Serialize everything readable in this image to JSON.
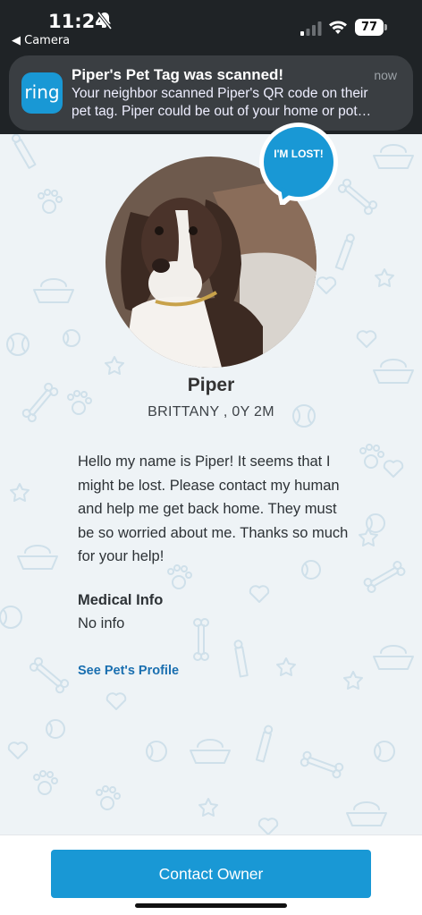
{
  "status_bar": {
    "time": "11:24",
    "back_label": "◀ Camera",
    "battery": "77"
  },
  "notification": {
    "app_logo": "ring",
    "title": "Piper's Pet Tag was scanned!",
    "time": "now",
    "body_line1": "Your neighbor scanned Piper's QR code on their",
    "body_line2": "pet tag. Piper could be out of your home or pot…"
  },
  "pet": {
    "lost_badge": "I'M LOST!",
    "name": "Piper",
    "breed_age": "BRITTANY , 0Y 2M",
    "message": "Hello my name is Piper! It seems that I might be lost. Please contact my human and help me get back home. They must be so worried about me. Thanks so much for your help!",
    "medical_title": "Medical Info",
    "medical_value": "No info",
    "profile_link": "See Pet's Profile"
  },
  "actions": {
    "contact_label": "Contact Owner"
  },
  "colors": {
    "accent": "#1998d5",
    "link": "#1a6fb0",
    "pattern": "#cfe0ea"
  }
}
